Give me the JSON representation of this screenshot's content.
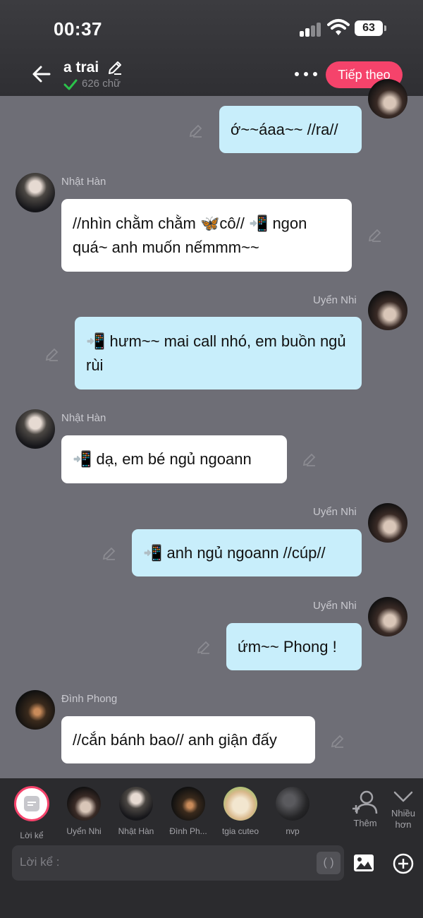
{
  "status_bar": {
    "time": "00:37",
    "battery": "63"
  },
  "header": {
    "title": "a trai",
    "word_count": "626 chữ",
    "next_button": "Tiếp theo"
  },
  "messages": [
    {
      "sender": "",
      "text": "ớ~~áaa~~ //ra//",
      "side": "right",
      "avatar": "uyen-nhi-avatar"
    },
    {
      "sender": "Nhật Hàn",
      "text": "//nhìn chằm chằm 🦋cô// 📲 ngon quá~ anh muốn nếmmm~~",
      "side": "left",
      "avatar": "nhat-han-avatar"
    },
    {
      "sender": "Uyển Nhi",
      "text": "📲 hưm~~ mai call nhó, em buồn ngủ rùi",
      "side": "right",
      "avatar": "uyen-nhi-avatar"
    },
    {
      "sender": "Nhật Hàn",
      "text": "📲 dạ, em bé ngủ ngoann",
      "side": "left",
      "avatar": "nhat-han-avatar"
    },
    {
      "sender": "Uyển Nhi",
      "text": "📲 anh ngủ ngoann //cúp//",
      "side": "right",
      "avatar": "uyen-nhi-avatar"
    },
    {
      "sender": "Uyển Nhi",
      "text": "ứm~~ Phong !",
      "side": "right",
      "avatar": "uyen-nhi-avatar"
    },
    {
      "sender": "Đình Phong",
      "text": "//cắn bánh bao// anh giận đấy",
      "side": "left",
      "avatar": "dinh-phong-avatar"
    }
  ],
  "characters": [
    {
      "label": "Lời kể",
      "icon": "narrator-icon"
    },
    {
      "label": "Uyển Nhi",
      "icon": "uyen-nhi-avatar"
    },
    {
      "label": "Nhật Hàn",
      "icon": "nhat-han-avatar"
    },
    {
      "label": "Đình Ph...",
      "icon": "dinh-phong-avatar"
    },
    {
      "label": "tgia cuteo",
      "icon": "cat-avatar"
    },
    {
      "label": "nvp",
      "icon": "nvp-avatar"
    }
  ],
  "add_character_label": "Thêm",
  "more_label_1": "Nhiều",
  "more_label_2": "hơn",
  "composer": {
    "placeholder": "Lời kể :",
    "bracket_button": "( )"
  },
  "colors": {
    "accent": "#f5436b",
    "bubble_right": "#c8eefb",
    "bubble_left": "#ffffff",
    "background": "#6e6e76",
    "header": "#333336"
  }
}
